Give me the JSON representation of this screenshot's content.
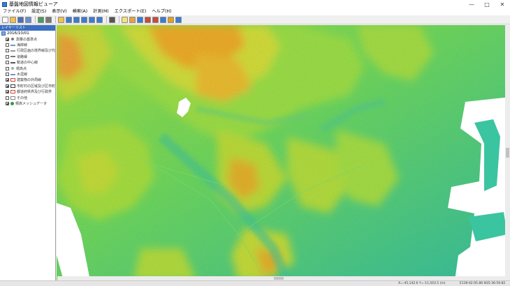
{
  "window": {
    "title": "基盤地図情報ビューア",
    "controls": [
      "—",
      "□",
      "✕"
    ]
  },
  "menu": [
    "ファイル(F)",
    "設定(S)",
    "表示(V)",
    "検索(A)",
    "計測(M)",
    "エクスポート(E)",
    "ヘルプ(H)"
  ],
  "toolbar": {
    "buttons": [
      {
        "icon": "new-file-icon",
        "color": "#ffffff"
      },
      {
        "icon": "open-folder-icon",
        "color": "#f2c14e"
      },
      {
        "icon": "save-icon",
        "color": "#4a6fb5"
      },
      {
        "icon": "export-icon",
        "color": "#6a8fd0"
      },
      {
        "icon": "sep"
      },
      {
        "icon": "layer-icon",
        "color": "#4c9a5b"
      },
      {
        "icon": "print-icon",
        "color": "#777777"
      },
      {
        "icon": "sep"
      },
      {
        "icon": "pan-icon",
        "color": "#f2c14e"
      },
      {
        "icon": "zoom-in-icon",
        "color": "#3a7bd5"
      },
      {
        "icon": "zoom-out-icon",
        "color": "#3a7bd5"
      },
      {
        "icon": "zoom-fit-icon",
        "color": "#3a7bd5"
      },
      {
        "icon": "zoom-window-icon",
        "color": "#3a7bd5"
      },
      {
        "icon": "full-extent-icon",
        "color": "#3a7bd5"
      },
      {
        "icon": "sep"
      },
      {
        "icon": "measure-icon",
        "color": "#555555"
      },
      {
        "icon": "sep"
      },
      {
        "icon": "select-icon",
        "color": "#f5e27a"
      },
      {
        "icon": "elevation-icon",
        "color": "#e9a13b"
      },
      {
        "icon": "profile-icon",
        "color": "#3a7bd5"
      },
      {
        "icon": "grid-icon",
        "color": "#c84a3c"
      },
      {
        "icon": "table-icon",
        "color": "#c84a3c"
      },
      {
        "icon": "chart-icon",
        "color": "#3a7bd5"
      },
      {
        "icon": "help-icon",
        "color": "#e0a020"
      },
      {
        "icon": "search-icon",
        "color": "#3a7bd5"
      }
    ]
  },
  "sidebar": {
    "header": "レイヤーリスト",
    "root": {
      "label": "2016/10/01",
      "icon": "database-icon"
    },
    "items": [
      {
        "label": "測量の基準点",
        "checked": true,
        "icon": "point-icon",
        "color": "#777777"
      },
      {
        "label": "海岸線",
        "checked": false,
        "icon": "line-icon",
        "color": "#6699cc"
      },
      {
        "label": "行政区画の境界線及び代...",
        "checked": false,
        "icon": "line-icon",
        "color": "#999999"
      },
      {
        "label": "道路縁",
        "checked": false,
        "icon": "line-icon",
        "color": "#777777"
      },
      {
        "label": "軌道の中心線",
        "checked": false,
        "icon": "line-icon",
        "color": "#555555"
      },
      {
        "label": "標高点",
        "checked": false,
        "icon": "point-icon",
        "color": "#aaaaaa"
      },
      {
        "label": "水涯線",
        "checked": false,
        "icon": "line-icon",
        "color": "#6699cc"
      },
      {
        "label": "建築物の外周線",
        "checked": true,
        "icon": "polygon-icon",
        "color": "#c84a3c"
      },
      {
        "label": "市町村の区域及び区市町...",
        "checked": true,
        "icon": "polygon-icon",
        "color": "#3a3a3a"
      },
      {
        "label": "都道府県界及び行政界",
        "checked": true,
        "icon": "polygon-icon",
        "color": "#c84a3c"
      },
      {
        "label": "その他",
        "checked": false,
        "icon": "folder-icon",
        "color": "#888888"
      },
      {
        "label": "標高メッシュデータ",
        "checked": true,
        "icon": "mesh-icon",
        "color": "#2e9e3e"
      }
    ]
  },
  "status": {
    "coords": "X=-45,142.6 Y=-11,503.5 (m)",
    "latlon": "E139:42:05.86 N35:36:59.82"
  },
  "colors": {
    "low": "#3bc4a0",
    "mid": "#8fe24a",
    "high": "#f2a424",
    "peak": "#e8702a",
    "water": "#ffffff"
  }
}
